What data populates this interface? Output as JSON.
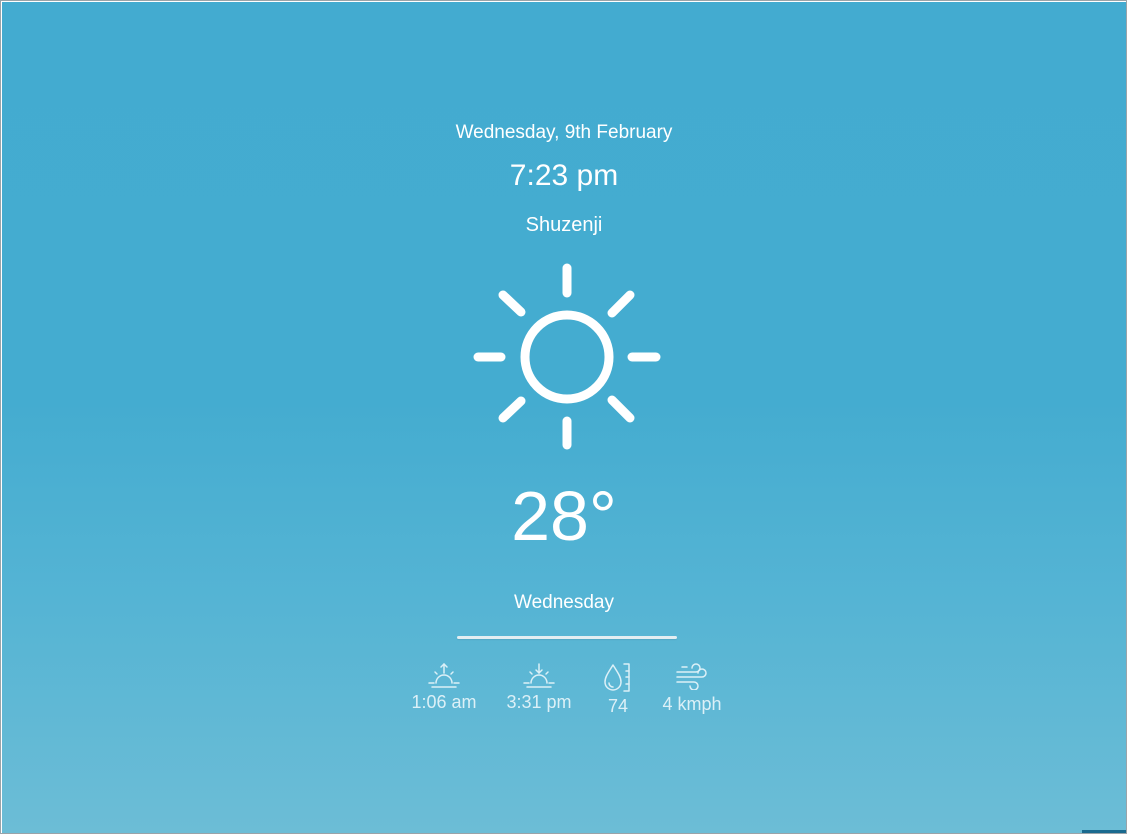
{
  "header": {
    "date": "Wednesday, 9th February",
    "time": "7:23 pm",
    "location": "Shuzenji"
  },
  "current": {
    "icon": "sun-icon",
    "temperature": "28°",
    "day": "Wednesday"
  },
  "stats": {
    "sunrise": {
      "icon": "sunrise-icon",
      "value": "1:06 am"
    },
    "sunset": {
      "icon": "sunset-icon",
      "value": "3:31 pm"
    },
    "humidity": {
      "icon": "humidity-icon",
      "value": "74"
    },
    "wind": {
      "icon": "wind-icon",
      "value": "4 kmph"
    }
  },
  "colors": {
    "background_top": "#43abd0",
    "background_bottom": "#6cbdd6",
    "text": "#ffffff"
  }
}
